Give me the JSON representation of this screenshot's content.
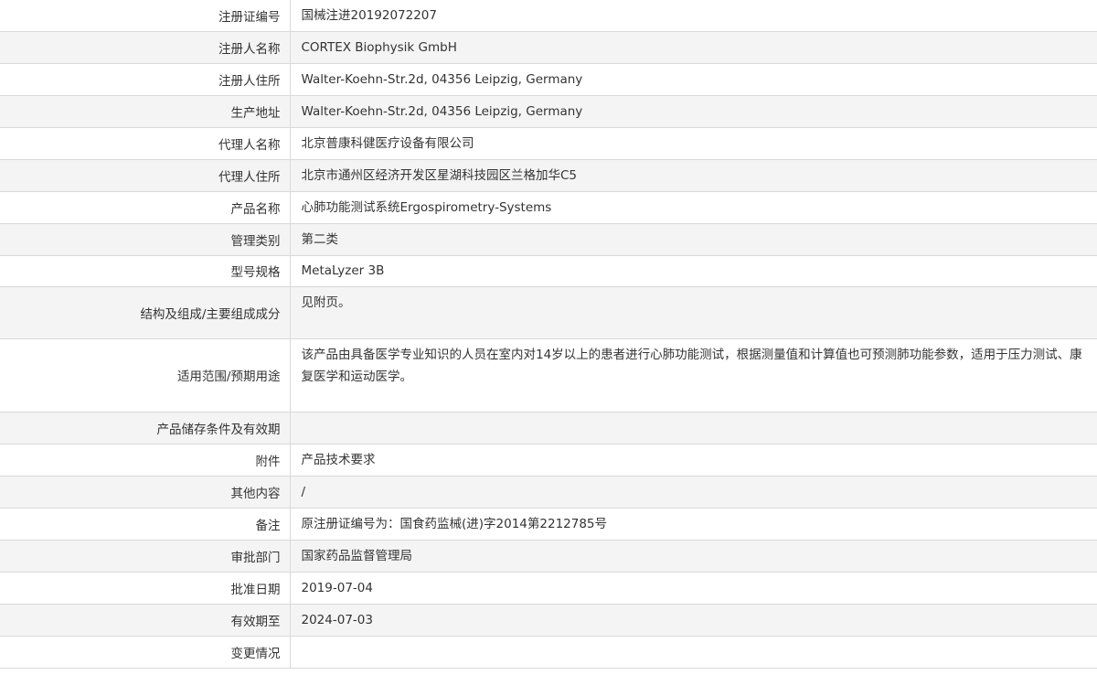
{
  "rows": [
    {
      "label": "注册证编号",
      "value": "国械注进20192072207"
    },
    {
      "label": "注册人名称",
      "value": "CORTEX Biophysik GmbH"
    },
    {
      "label": "注册人住所",
      "value": "Walter-Koehn-Str.2d, 04356 Leipzig, Germany"
    },
    {
      "label": "生产地址",
      "value": "Walter-Koehn-Str.2d, 04356 Leipzig, Germany"
    },
    {
      "label": "代理人名称",
      "value": "北京普康科健医疗设备有限公司"
    },
    {
      "label": "代理人住所",
      "value": "北京市通州区经济开发区星湖科技园区兰格加华C5"
    },
    {
      "label": "产品名称",
      "value": "心肺功能测试系统Ergospirometry-Systems"
    },
    {
      "label": "管理类别",
      "value": "第二类"
    },
    {
      "label": "型号规格",
      "value": "MetaLyzer 3B"
    },
    {
      "label": "结构及组成/主要组成成分",
      "value": "见附页。"
    },
    {
      "label": "适用范围/预期用途",
      "value": "该产品由具备医学专业知识的人员在室内对14岁以上的患者进行心肺功能测试，根据测量值和计算值也可预测肺功能参数，适用于压力测试、康复医学和运动医学。"
    },
    {
      "label": "产品储存条件及有效期",
      "value": ""
    },
    {
      "label": "附件",
      "value": "产品技术要求"
    },
    {
      "label": "其他内容",
      "value": "/"
    },
    {
      "label": "备注",
      "value": "原注册证编号为：国食药监械(进)字2014第2212785号"
    },
    {
      "label": "审批部门",
      "value": "国家药品监督管理局"
    },
    {
      "label": "批准日期",
      "value": "2019-07-04"
    },
    {
      "label": "有效期至",
      "value": "2024-07-03"
    },
    {
      "label": "变更情况",
      "value": ""
    }
  ]
}
